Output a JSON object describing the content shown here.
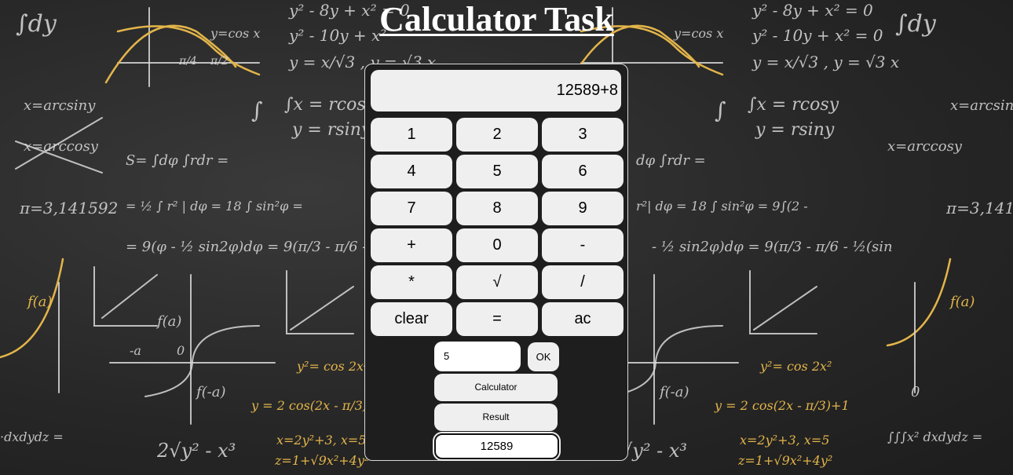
{
  "page": {
    "title": "Calculator Task"
  },
  "calculator": {
    "display": "12589+8",
    "keys": [
      "1",
      "2",
      "3",
      "4",
      "5",
      "6",
      "7",
      "8",
      "9",
      "+",
      "0",
      "-",
      "*",
      "√",
      "/",
      "clear",
      "=",
      "ac"
    ]
  },
  "controls": {
    "input_value": "5",
    "ok_label": "OK",
    "calculator_label": "Calculator",
    "result_label": "Result",
    "result_value": "12589"
  },
  "colors": {
    "button_bg": "#efefef",
    "panel_bg": "#1e1e1e",
    "chalk_yellow": "#e3b54a"
  }
}
